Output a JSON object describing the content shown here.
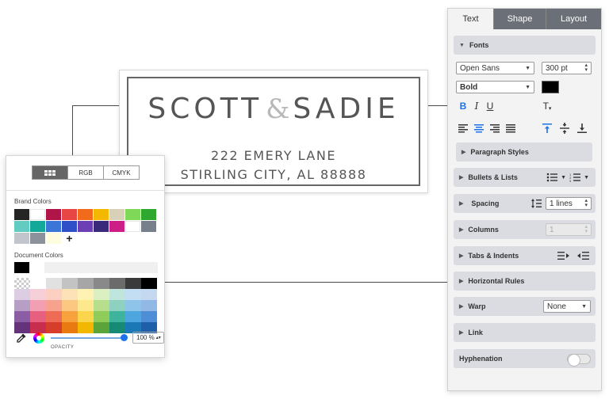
{
  "label": {
    "title_left": "SCOTT",
    "ampersand": "&",
    "title_right": "SADIE",
    "address_line1": "222 EMERY LANE",
    "address_line2": "STIRLING CITY, AL 88888"
  },
  "color_panel": {
    "tabs": [
      {
        "label": "",
        "icon": "grid-icon",
        "active": true
      },
      {
        "label": "RGB",
        "active": false
      },
      {
        "label": "CMYK",
        "active": false
      }
    ],
    "brand_colors_label": "Brand Colors",
    "document_colors_label": "Document Colors",
    "brand_swatches": [
      "#252525",
      "#ffffff",
      "#b01549",
      "#e84545",
      "#f26a1b",
      "#f5b800",
      "#d9d0b8",
      "#7fd857",
      "#2fa82f",
      "#62ccc3",
      "#14a89b",
      "#3c75d8",
      "#2f4fc9",
      "#6c3fb5",
      "#3a2b7a",
      "#cc1e86",
      "#ffffff",
      "#777f8a",
      "#c2c6cc",
      "#8b929b",
      "#fffde0"
    ],
    "document_swatches": [
      "#000000",
      "#ffffff"
    ],
    "palette": [
      "checker",
      "#ffffff",
      "#e1e1e1",
      "#c3c3c3",
      "#a6a6a6",
      "#898989",
      "#6b6b6b",
      "#3a3a3a",
      "#000000",
      "#dccde3",
      "#f7cfd8",
      "#fbd0c2",
      "#fde2b8",
      "#fff2b3",
      "#dcefc1",
      "#bfe5dc",
      "#c3def3",
      "#c4d8f0",
      "#b79ec5",
      "#f29fb3",
      "#f6a28f",
      "#fbc781",
      "#fde88e",
      "#b7de8d",
      "#8fd1c0",
      "#8fc4ea",
      "#92b9e5",
      "#8a5da4",
      "#e8607f",
      "#ee6b55",
      "#f7a23c",
      "#fbd54c",
      "#8fcc5a",
      "#3fb49c",
      "#4ea6df",
      "#4f8ed6",
      "#64337a",
      "#c92d4e",
      "#d63d2a",
      "#e97a11",
      "#f2b800",
      "#5ba43a",
      "#168a74",
      "#1978b5",
      "#1f5ea8"
    ],
    "opacity_value": "100 %",
    "opacity_fraction": 1.0,
    "opacity_label": "OPACITY"
  },
  "right_panel": {
    "tabs": [
      {
        "label": "Text",
        "active": true
      },
      {
        "label": "Shape",
        "active": false
      },
      {
        "label": "Layout",
        "active": false
      }
    ],
    "fonts_label": "Fonts",
    "font_family": "Open Sans",
    "font_size": "300 pt",
    "font_weight": "Bold",
    "text_color": "#000000",
    "paragraph_styles_label": "Paragraph Styles",
    "bullets_label": "Bullets & Lists",
    "spacing_label": "Spacing",
    "spacing_value": "1 lines",
    "columns_label": "Columns",
    "columns_value": "1",
    "tabs_indents_label": "Tabs & Indents",
    "horizontal_rules_label": "Horizontal Rules",
    "warp_label": "Warp",
    "warp_value": "None",
    "link_label": "Link",
    "hyphenation_label": "Hyphenation",
    "hyphenation_on": false,
    "bold_glyph": "B",
    "italic_glyph": "I",
    "underline_glyph": "U",
    "text_transform_glyph": "T"
  },
  "colors": {
    "accent": "#1a73e8",
    "tab_inactive": "#6b6f78",
    "section_bg": "#dadce1"
  }
}
